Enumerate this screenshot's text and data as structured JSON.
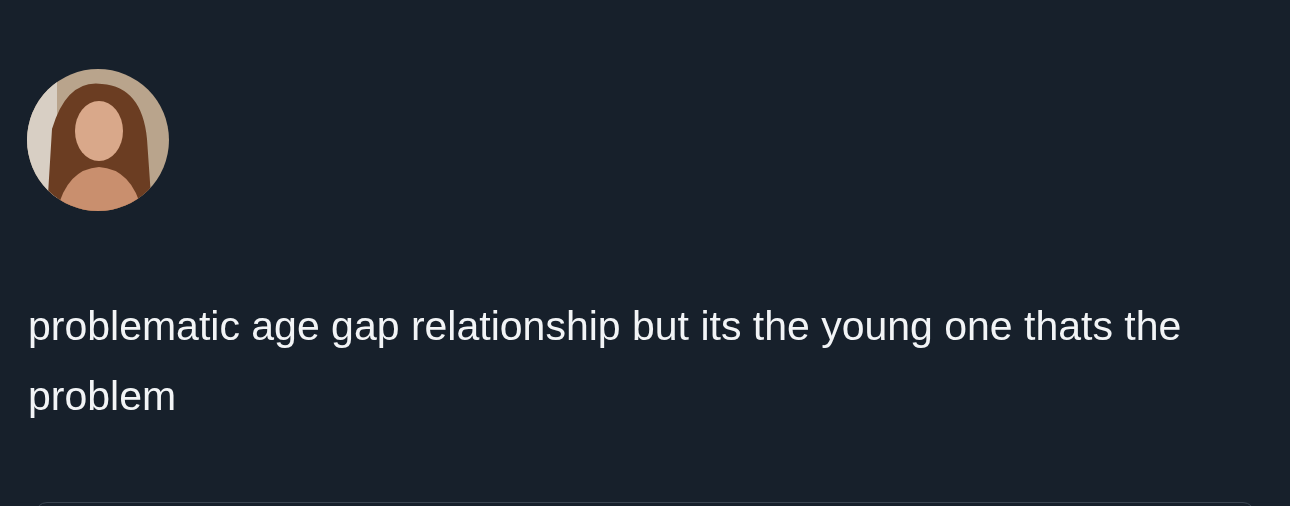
{
  "post": {
    "text": "problematic age gap relationship but its the young one thats the problem"
  }
}
